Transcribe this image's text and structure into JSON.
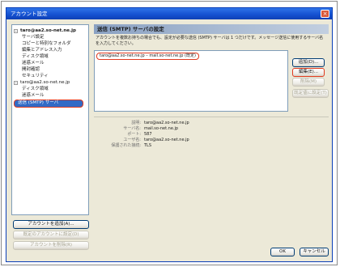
{
  "window": {
    "title": "アカウント設定",
    "close_glyph": "×"
  },
  "tree": {
    "items": [
      {
        "label": "taro@aa2.so-net.ne.jp",
        "level": 0,
        "toggle": "-"
      },
      {
        "label": "サーバ設定",
        "level": 1
      },
      {
        "label": "コピーと特別なフォルダ",
        "level": 1
      },
      {
        "label": "編集とアドレス入力",
        "level": 1
      },
      {
        "label": "ディスク領域",
        "level": 1
      },
      {
        "label": "迷惑メール",
        "level": 1
      },
      {
        "label": "開封確認",
        "level": 1
      },
      {
        "label": "セキュリティ",
        "level": 1
      },
      {
        "label": "taro@aa2.so-net.ne.jp",
        "level": 0,
        "toggle": "-"
      },
      {
        "label": "ディスク領域",
        "level": 1
      },
      {
        "label": "迷惑メール",
        "level": 1
      },
      {
        "label": "送信 (SMTP) サーバ",
        "level": 0,
        "selected": true
      }
    ]
  },
  "left_buttons": {
    "add_account": "アカウントを追加(A)...",
    "set_default": "既定のアカウントに設定(D)",
    "remove_account": "アカウントを削除(R)"
  },
  "panel": {
    "header": "送信 (SMTP) サーバの設定",
    "description": "アカウントを複数お持ちの場合でも、設定が必要な送信 (SMTP) サーバは 1 つだけです。メッセージ送信に使用するサーバ名を入力してください。",
    "server_entry": "taro@aa2.so-net.ne.jp – mail.so-net.ne.jp (既定)",
    "buttons": {
      "add": "追加(D)...",
      "edit": "編集(E)...",
      "delete": "削除(M)",
      "set_default": "既定値に設定(T)"
    },
    "details": [
      {
        "label": "説明:",
        "value": "taro@aa2.so-net.ne.jp"
      },
      {
        "label": "サーバ名:",
        "value": "mail.so-net.ne.jp"
      },
      {
        "label": "ポート:",
        "value": "587"
      },
      {
        "label": "ユーザ名:",
        "value": "taro@aa2.so-net.ne.jp"
      },
      {
        "label": "保護された接続:",
        "value": "TLS"
      }
    ]
  },
  "footer": {
    "ok": "OK",
    "cancel": "キャンセル"
  },
  "colors": {
    "highlight": "#e03a1f",
    "selection": "#316ac5",
    "titlebar": "#1450d0"
  }
}
